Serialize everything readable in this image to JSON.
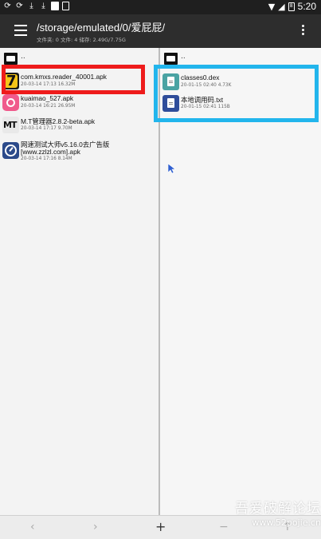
{
  "status_bar": {
    "time": "5:20",
    "battery_label": "8"
  },
  "app_bar": {
    "path": "/storage/emulated/0/爱屁屁/",
    "summary": "文件夹: 0  文件: 4  储存: 2.49G/7.75G"
  },
  "left_pane": {
    "parent_label": "..",
    "files": [
      {
        "name": "com.kmxs.reader_40001.apk",
        "meta": "20-03-14 17:13  16.32M",
        "icon": "kmxs-app-icon"
      },
      {
        "name": "kuaimao_527.apk",
        "meta": "20-03-14 16:21  26.95M",
        "icon": "kuaimao-app-icon"
      },
      {
        "name": "M.T管理器2.8.2-beta.apk",
        "meta": "20-03-14 17:17  9.70M",
        "icon": "mt-manager-app-icon"
      },
      {
        "name": "网速测试大师v5.16.0去广告版",
        "name2": "[www.zzlzl.com].apk",
        "meta": "20-03-14 17:16  8.14M",
        "icon": "speedtest-app-icon"
      }
    ]
  },
  "right_pane": {
    "parent_label": "..",
    "files": [
      {
        "name": "classes0.dex",
        "meta": "20-01-15 02:40  4.73K",
        "icon": "dex-file-icon"
      },
      {
        "name": "本地调用码.txt",
        "meta": "20-01-15 02:41  115B",
        "icon": "txt-file-icon"
      }
    ]
  },
  "bottom_bar": {
    "back": "‹",
    "forward": "›",
    "add": "+",
    "minus": "−",
    "up": "↑"
  },
  "watermark": {
    "cn": "吾爱破解论坛",
    "url": "www.52pojie.cn"
  },
  "colors": {
    "highlight_red": "#ee1b1b",
    "highlight_blue": "#22b5ec",
    "app_bar": "#2d2d2d"
  }
}
